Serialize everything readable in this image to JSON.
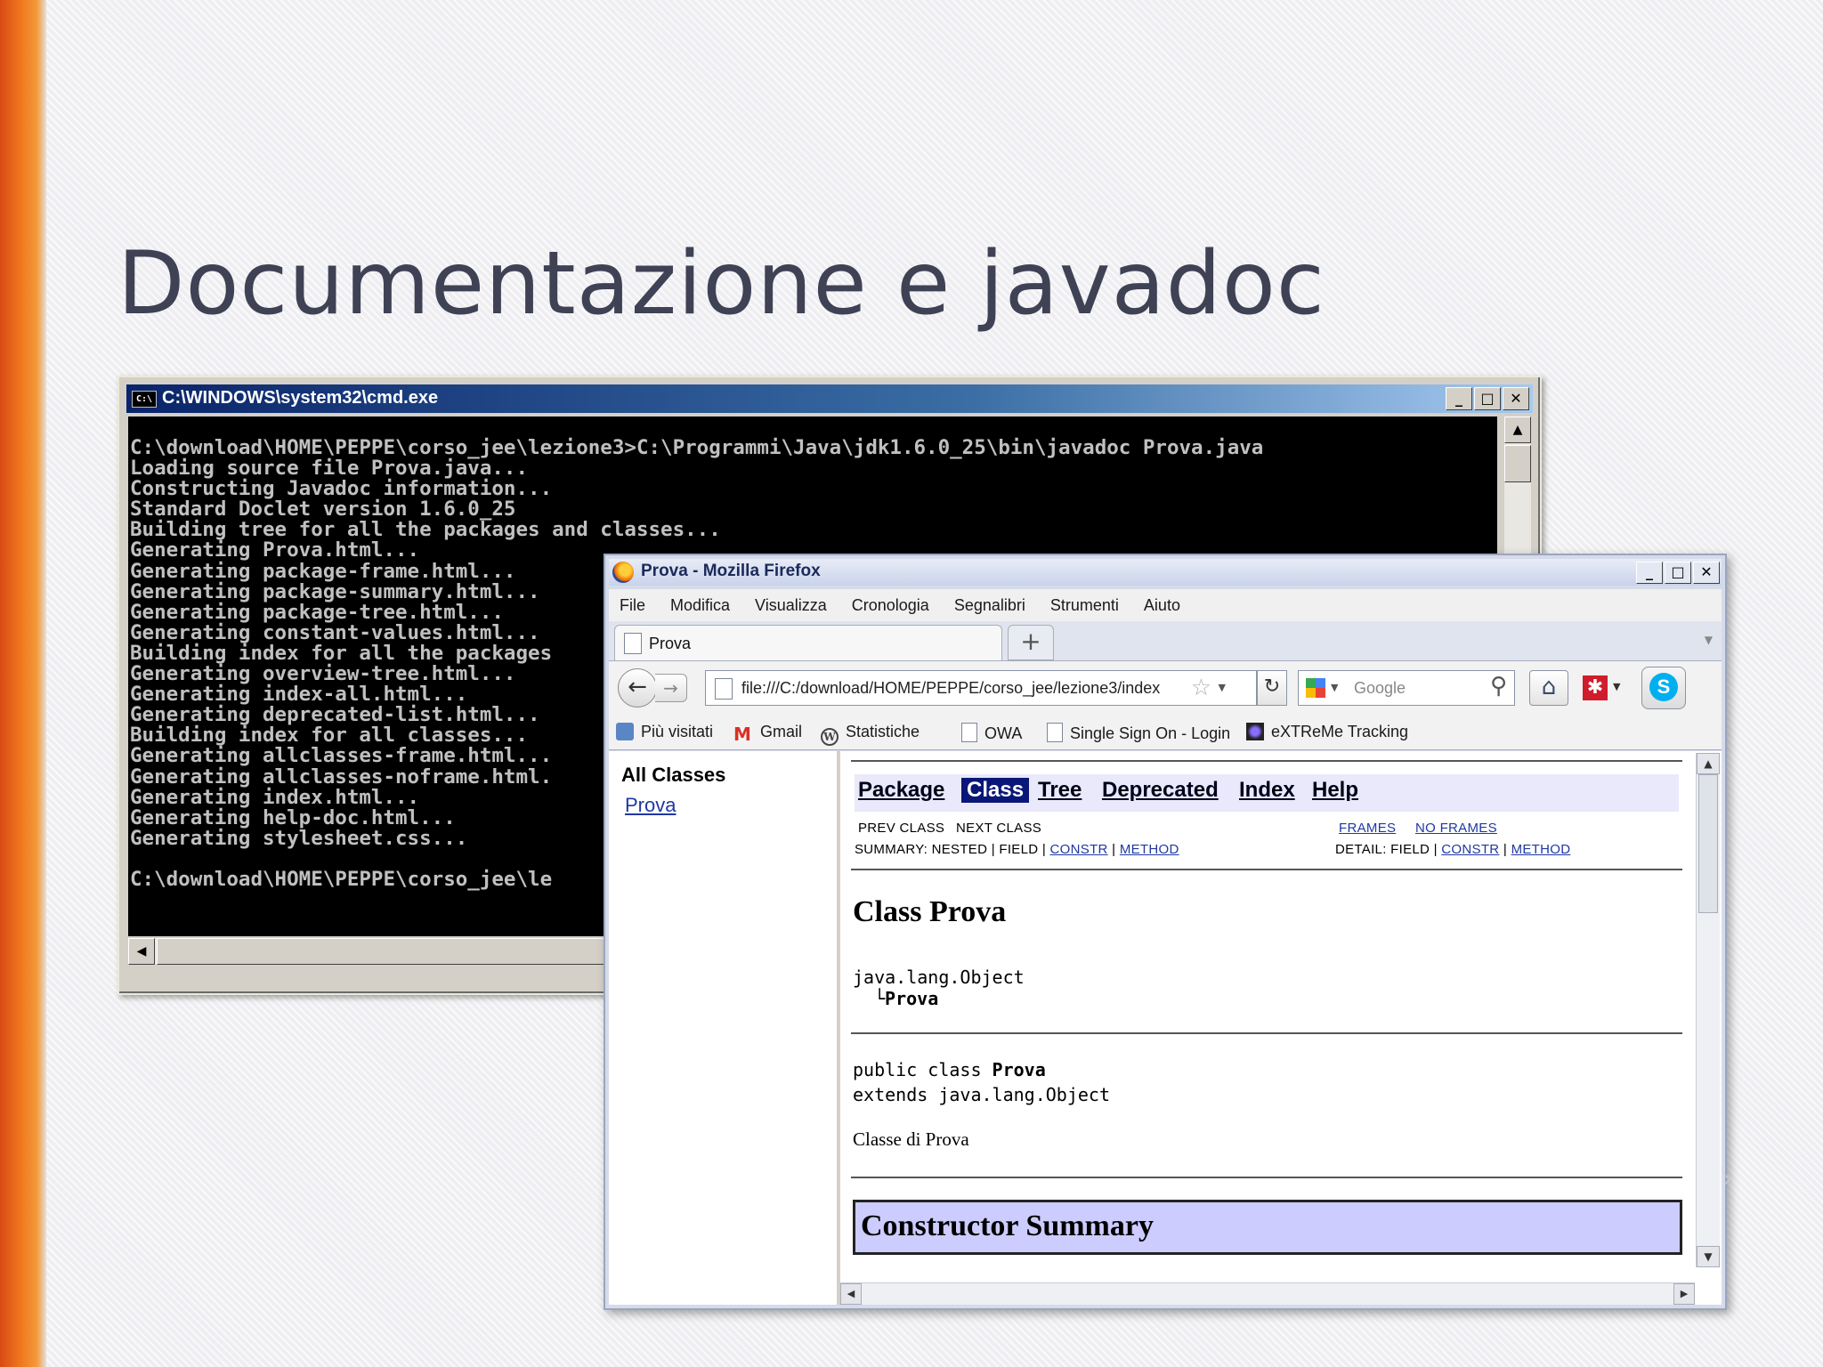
{
  "slide": {
    "title": "Documentazione e javadoc"
  },
  "cmd": {
    "title": "C:\\WINDOWS\\system32\\cmd.exe",
    "icon_label": "C:\\",
    "buttons": {
      "minimize": "_",
      "maximize": "□",
      "close": "✕"
    },
    "lines": [
      "C:\\download\\HOME\\PEPPE\\corso_jee\\lezione3>C:\\Programmi\\Java\\jdk1.6.0_25\\bin\\javadoc Prova.java",
      "Loading source file Prova.java...",
      "Constructing Javadoc information...",
      "Standard Doclet version 1.6.0_25",
      "Building tree for all the packages and classes...",
      "Generating Prova.html...",
      "Generating package-frame.html...",
      "Generating package-summary.html...",
      "Generating package-tree.html...",
      "Generating constant-values.html...",
      "Building index for all the packages",
      "Generating overview-tree.html...",
      "Generating index-all.html...",
      "Generating deprecated-list.html...",
      "Building index for all classes...",
      "Generating allclasses-frame.html...",
      "Generating allclasses-noframe.html.",
      "Generating index.html...",
      "Generating help-doc.html...",
      "Generating stylesheet.css...",
      "",
      "C:\\download\\HOME\\PEPPE\\corso_jee\\le"
    ]
  },
  "firefox": {
    "title": "Prova - Mozilla Firefox",
    "buttons": {
      "minimize": "_",
      "maximize": "□",
      "close": "✕"
    },
    "menu": [
      "File",
      "Modifica",
      "Visualizza",
      "Cronologia",
      "Segnalibri",
      "Strumenti",
      "Aiuto"
    ],
    "tab": {
      "label": "Prova",
      "new_tab": "+"
    },
    "url": "file:///C:/download/HOME/PEPPE/corso_jee/lezione3/index",
    "search": {
      "placeholder": "Google"
    },
    "bookmarks": [
      "Più visitati",
      "Gmail",
      "Statistiche",
      "OWA",
      "Single Sign On - Login",
      "eXTReMe Tracking"
    ],
    "left_frame": {
      "heading": "All Classes",
      "classes": [
        "Prova"
      ]
    },
    "javadoc": {
      "nav": [
        "Package",
        "Class",
        "Tree",
        "Deprecated",
        "Index",
        "Help"
      ],
      "active_nav": "Class",
      "prev_class": "PREV CLASS",
      "next_class": "NEXT CLASS",
      "frames": "FRAMES",
      "no_frames": "NO FRAMES",
      "summary_prefix": "SUMMARY: NESTED | FIELD |",
      "summary_constr": "CONSTR",
      "summary_sep": "|",
      "summary_method": "METHOD",
      "detail_prefix": "DETAIL: FIELD |",
      "detail_constr": "CONSTR",
      "detail_sep": "|",
      "detail_method": "METHOD",
      "class_heading": "Class Prova",
      "inheritance_parent": "java.lang.Object",
      "inheritance_child": "Prova",
      "decl_prefix": "public class ",
      "decl_class": "Prova",
      "decl_extends": "extends java.lang.Object",
      "description": "Classe di Prova",
      "constructor_summary": "Constructor Summary"
    }
  },
  "colors": {
    "accent_orange": "#f0781e",
    "title_text": "#3f4254",
    "javadoc_nav_bg": "#e9e9fb",
    "javadoc_active": "#0a1778",
    "ctor_header_bg": "#ccccff",
    "link": "#1f38a3"
  }
}
